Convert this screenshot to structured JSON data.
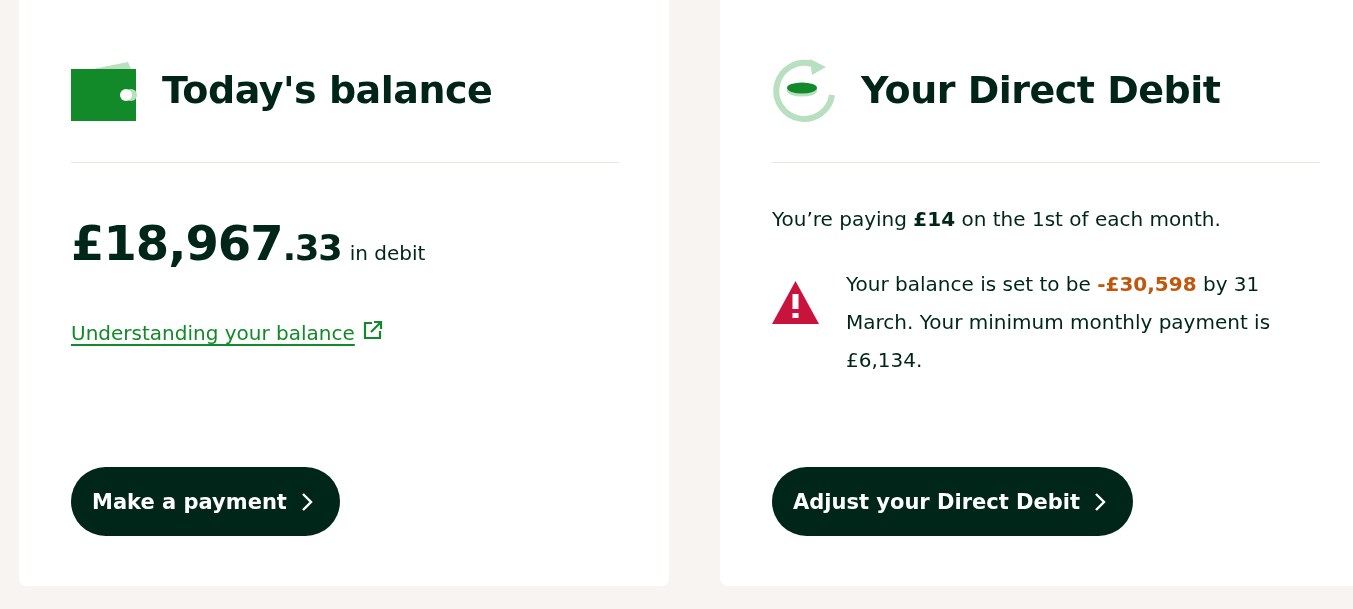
{
  "cards": [
    {
      "kind": "balance",
      "title": "Today's balance",
      "amount": "£18,967",
      "pence": ".33",
      "amount_note": "in debit",
      "link": "Understanding your balance",
      "button": "Make a payment"
    },
    {
      "kind": "direct_debit",
      "title": "Your Direct Debit",
      "summary": "You’re paying **£14** on the 1st of each month.",
      "alert": "Your balance is set to be **-£30,598** by 31 March. Your minimum monthly payment is £6,134.",
      "button": "Adjust your Direct Debit"
    }
  ]
}
